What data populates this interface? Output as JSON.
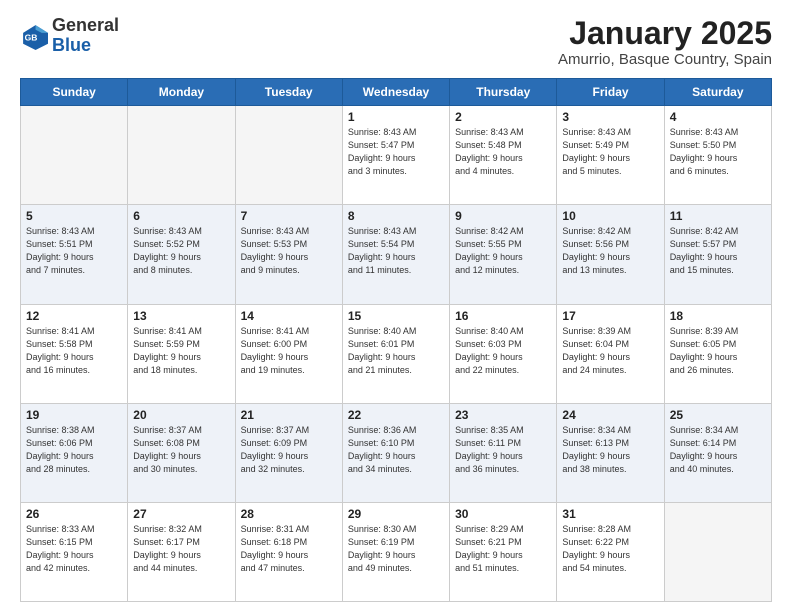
{
  "header": {
    "logo_general": "General",
    "logo_blue": "Blue",
    "title": "January 2025",
    "location": "Amurrio, Basque Country, Spain"
  },
  "days_of_week": [
    "Sunday",
    "Monday",
    "Tuesday",
    "Wednesday",
    "Thursday",
    "Friday",
    "Saturday"
  ],
  "weeks": [
    [
      {
        "day": "",
        "info": ""
      },
      {
        "day": "",
        "info": ""
      },
      {
        "day": "",
        "info": ""
      },
      {
        "day": "1",
        "info": "Sunrise: 8:43 AM\nSunset: 5:47 PM\nDaylight: 9 hours\nand 3 minutes."
      },
      {
        "day": "2",
        "info": "Sunrise: 8:43 AM\nSunset: 5:48 PM\nDaylight: 9 hours\nand 4 minutes."
      },
      {
        "day": "3",
        "info": "Sunrise: 8:43 AM\nSunset: 5:49 PM\nDaylight: 9 hours\nand 5 minutes."
      },
      {
        "day": "4",
        "info": "Sunrise: 8:43 AM\nSunset: 5:50 PM\nDaylight: 9 hours\nand 6 minutes."
      }
    ],
    [
      {
        "day": "5",
        "info": "Sunrise: 8:43 AM\nSunset: 5:51 PM\nDaylight: 9 hours\nand 7 minutes."
      },
      {
        "day": "6",
        "info": "Sunrise: 8:43 AM\nSunset: 5:52 PM\nDaylight: 9 hours\nand 8 minutes."
      },
      {
        "day": "7",
        "info": "Sunrise: 8:43 AM\nSunset: 5:53 PM\nDaylight: 9 hours\nand 9 minutes."
      },
      {
        "day": "8",
        "info": "Sunrise: 8:43 AM\nSunset: 5:54 PM\nDaylight: 9 hours\nand 11 minutes."
      },
      {
        "day": "9",
        "info": "Sunrise: 8:42 AM\nSunset: 5:55 PM\nDaylight: 9 hours\nand 12 minutes."
      },
      {
        "day": "10",
        "info": "Sunrise: 8:42 AM\nSunset: 5:56 PM\nDaylight: 9 hours\nand 13 minutes."
      },
      {
        "day": "11",
        "info": "Sunrise: 8:42 AM\nSunset: 5:57 PM\nDaylight: 9 hours\nand 15 minutes."
      }
    ],
    [
      {
        "day": "12",
        "info": "Sunrise: 8:41 AM\nSunset: 5:58 PM\nDaylight: 9 hours\nand 16 minutes."
      },
      {
        "day": "13",
        "info": "Sunrise: 8:41 AM\nSunset: 5:59 PM\nDaylight: 9 hours\nand 18 minutes."
      },
      {
        "day": "14",
        "info": "Sunrise: 8:41 AM\nSunset: 6:00 PM\nDaylight: 9 hours\nand 19 minutes."
      },
      {
        "day": "15",
        "info": "Sunrise: 8:40 AM\nSunset: 6:01 PM\nDaylight: 9 hours\nand 21 minutes."
      },
      {
        "day": "16",
        "info": "Sunrise: 8:40 AM\nSunset: 6:03 PM\nDaylight: 9 hours\nand 22 minutes."
      },
      {
        "day": "17",
        "info": "Sunrise: 8:39 AM\nSunset: 6:04 PM\nDaylight: 9 hours\nand 24 minutes."
      },
      {
        "day": "18",
        "info": "Sunrise: 8:39 AM\nSunset: 6:05 PM\nDaylight: 9 hours\nand 26 minutes."
      }
    ],
    [
      {
        "day": "19",
        "info": "Sunrise: 8:38 AM\nSunset: 6:06 PM\nDaylight: 9 hours\nand 28 minutes."
      },
      {
        "day": "20",
        "info": "Sunrise: 8:37 AM\nSunset: 6:08 PM\nDaylight: 9 hours\nand 30 minutes."
      },
      {
        "day": "21",
        "info": "Sunrise: 8:37 AM\nSunset: 6:09 PM\nDaylight: 9 hours\nand 32 minutes."
      },
      {
        "day": "22",
        "info": "Sunrise: 8:36 AM\nSunset: 6:10 PM\nDaylight: 9 hours\nand 34 minutes."
      },
      {
        "day": "23",
        "info": "Sunrise: 8:35 AM\nSunset: 6:11 PM\nDaylight: 9 hours\nand 36 minutes."
      },
      {
        "day": "24",
        "info": "Sunrise: 8:34 AM\nSunset: 6:13 PM\nDaylight: 9 hours\nand 38 minutes."
      },
      {
        "day": "25",
        "info": "Sunrise: 8:34 AM\nSunset: 6:14 PM\nDaylight: 9 hours\nand 40 minutes."
      }
    ],
    [
      {
        "day": "26",
        "info": "Sunrise: 8:33 AM\nSunset: 6:15 PM\nDaylight: 9 hours\nand 42 minutes."
      },
      {
        "day": "27",
        "info": "Sunrise: 8:32 AM\nSunset: 6:17 PM\nDaylight: 9 hours\nand 44 minutes."
      },
      {
        "day": "28",
        "info": "Sunrise: 8:31 AM\nSunset: 6:18 PM\nDaylight: 9 hours\nand 47 minutes."
      },
      {
        "day": "29",
        "info": "Sunrise: 8:30 AM\nSunset: 6:19 PM\nDaylight: 9 hours\nand 49 minutes."
      },
      {
        "day": "30",
        "info": "Sunrise: 8:29 AM\nSunset: 6:21 PM\nDaylight: 9 hours\nand 51 minutes."
      },
      {
        "day": "31",
        "info": "Sunrise: 8:28 AM\nSunset: 6:22 PM\nDaylight: 9 hours\nand 54 minutes."
      },
      {
        "day": "",
        "info": ""
      }
    ]
  ]
}
